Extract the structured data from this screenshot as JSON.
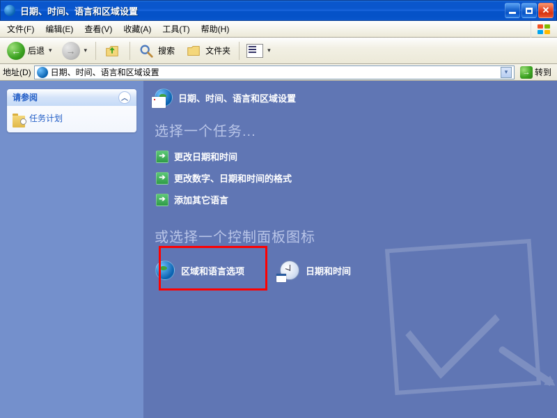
{
  "titlebar": {
    "title": "日期、时间、语言和区域设置"
  },
  "menubar": {
    "file": "文件(F)",
    "edit": "编辑(E)",
    "view": "查看(V)",
    "favorites": "收藏(A)",
    "tools": "工具(T)",
    "help": "帮助(H)"
  },
  "toolbar": {
    "back": "后退",
    "search": "搜索",
    "folders": "文件夹"
  },
  "addressbar": {
    "label": "地址(D)",
    "value": "日期、时间、语言和区域设置",
    "go": "转到"
  },
  "sidebar": {
    "seealso_header": "请参阅",
    "seealso_items": [
      {
        "label": "任务计划"
      }
    ]
  },
  "content": {
    "header": "日期、时间、语言和区域设置",
    "section_task": "选择一个任务...",
    "tasks": [
      "更改日期和时间",
      "更改数字、日期和时间的格式",
      "添加其它语言"
    ],
    "section_icons": "或选择一个控制面板图标",
    "icons": [
      {
        "label": "区域和语言选项"
      },
      {
        "label": "日期和时间"
      }
    ]
  }
}
